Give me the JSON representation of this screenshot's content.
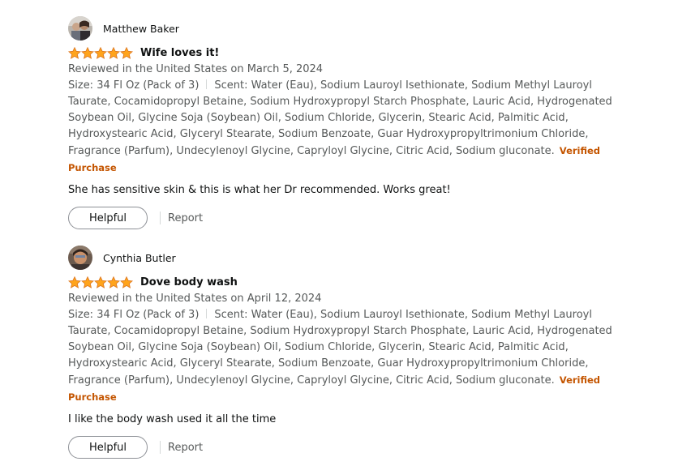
{
  "reviews": [
    {
      "profile_name": "Matthew Baker",
      "rating": 5,
      "rating_max": 5,
      "title": "Wife loves it!",
      "date": "Reviewed in the United States on March 5, 2024",
      "size": "Size: 34 Fl Oz (Pack of 3)",
      "scent": "Scent: Water (Eau), Sodium Lauroyl Isethionate, Sodium Methyl Lauroyl Taurate, Cocamidopropyl Betaine, Sodium Hydroxypropyl Starch Phosphate, Lauric Acid, Hydrogenated Soybean Oil, Glycine Soja (Soybean) Oil, Sodium Chloride, Glycerin, Stearic Acid, Palmitic Acid, Hydroxystearic Acid, Glyceryl Stearate, Sodium Benzoate, Guar Hydroxypropyltrimonium Chloride, Fragrance (Parfum), Undecylenoyl Glycine, Capryloyl Glycine, Citric Acid, Sodium gluconate.",
      "verified": "Verified Purchase",
      "body": "She has sensitive skin & this is what her Dr recommended. Works great!",
      "helpful_label": "Helpful",
      "report_label": "Report"
    },
    {
      "profile_name": "Cynthia Butler",
      "rating": 5,
      "rating_max": 5,
      "title": "Dove body wash",
      "date": "Reviewed in the United States on April 12, 2024",
      "size": "Size: 34 Fl Oz (Pack of 3)",
      "scent": "Scent: Water (Eau), Sodium Lauroyl Isethionate, Sodium Methyl Lauroyl Taurate, Cocamidopropyl Betaine, Sodium Hydroxypropyl Starch Phosphate, Lauric Acid, Hydrogenated Soybean Oil, Glycine Soja (Soybean) Oil, Sodium Chloride, Glycerin, Stearic Acid, Palmitic Acid, Hydroxystearic Acid, Glyceryl Stearate, Sodium Benzoate, Guar Hydroxypropyltrimonium Chloride, Fragrance (Parfum), Undecylenoyl Glycine, Capryloyl Glycine, Citric Acid, Sodium gluconate.",
      "verified": "Verified Purchase",
      "body": "I like the body wash used it all the time",
      "helpful_label": "Helpful",
      "report_label": "Report"
    }
  ],
  "colors": {
    "star": "#ffa41c",
    "star_outline": "#de7921",
    "verified": "#c45500",
    "muted_text": "#565959"
  }
}
